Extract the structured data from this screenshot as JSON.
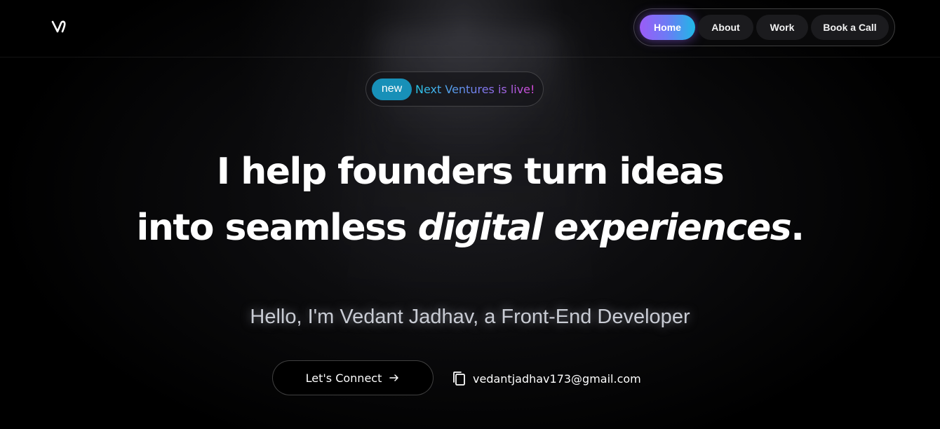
{
  "header": {
    "logo_icon": "v-monogram-logo",
    "nav": [
      {
        "label": "Home",
        "active": true
      },
      {
        "label": "About",
        "active": false
      },
      {
        "label": "Work",
        "active": false
      },
      {
        "label": "Book a Call",
        "active": false
      }
    ]
  },
  "badge": {
    "pill": "new",
    "text": "Next Ventures is live!"
  },
  "hero": {
    "line1": "I help founders turn ideas",
    "line2_plain": "into seamless ",
    "line2_italic": "digital experiences",
    "line2_end": ".",
    "subtitle": "Hello, I'm Vedant Jadhav, a Front-End Developer"
  },
  "cta": {
    "connect_label": "Let's Connect",
    "connect_icon": "arrow-right-icon",
    "email": "vedantjadhav173@gmail.com",
    "email_icon": "copy-icon"
  },
  "colors": {
    "accent_purple": "#9b5cf6",
    "accent_cyan": "#1fb8e6",
    "badge_pill": "#1890b8"
  }
}
